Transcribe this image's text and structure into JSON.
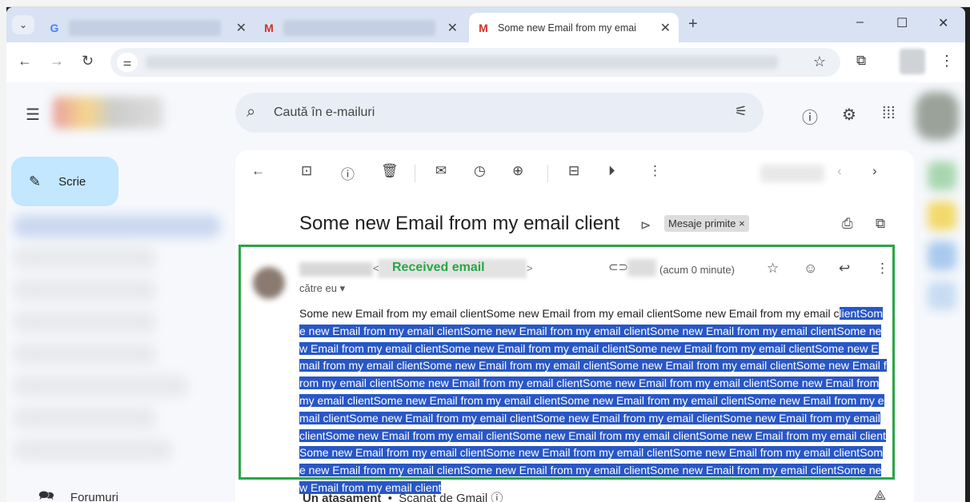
{
  "browser": {
    "tabs": [
      {
        "favicon": "G",
        "title": "",
        "active": false
      },
      {
        "favicon": "M",
        "title": "M I",
        "active": false
      },
      {
        "favicon": "M",
        "title": "Some new Email from my emai",
        "active": true
      }
    ],
    "new_tab_symbol": "+",
    "window_controls": [
      "–",
      "☐",
      "✕"
    ]
  },
  "gmail": {
    "search_placeholder": "Caută în e-mailuri",
    "compose_label": "Scrie",
    "sidebar_bottom_item": "Forumuri",
    "email": {
      "subject": "Some new Email from my email client",
      "inbox_chip": "Mesaje primite",
      "chip_close": "×",
      "annotation": "Received email",
      "time": "(acum 0 minute)",
      "to_line": "către eu",
      "body_unselected": "Some new Email from my email clientSome new Email from my email clientSome new Email from my email c",
      "body_selected": "lientSome new Email from my email clientSome new Email from my email clientSome new Email from my email clientSome new Email from my email clientSome new Email from my email clientSome new Email from my email clientSome new Email from my email clientSome new Email from my email clientSome new Email from my email clientSome new Email from my email clientSome new Email from my email clientSome new Email from my email clientSome new Email from my email clientSome new Email from my email clientSome new Email from my email clientSome new Email from my email clientSome new Email from my email clientSome new Email from my email clientSome new Email from my email clientSome new Email from my email clientSome new Email from my email clientSome new Email from my email clientSome new Email from my email clientSome new Email from my email clientSome new Email from my email clientSome new Email from my email clientSome new Email from my email clientSome new Email from my email clientSome new Email from my email client",
      "attachment_count": "Un atașament",
      "attachment_scan": "Scanat de Gmail"
    }
  },
  "colors": {
    "selection": "#2857c6",
    "annotation_green": "#28a745",
    "compose_bg": "#c2e7ff"
  }
}
